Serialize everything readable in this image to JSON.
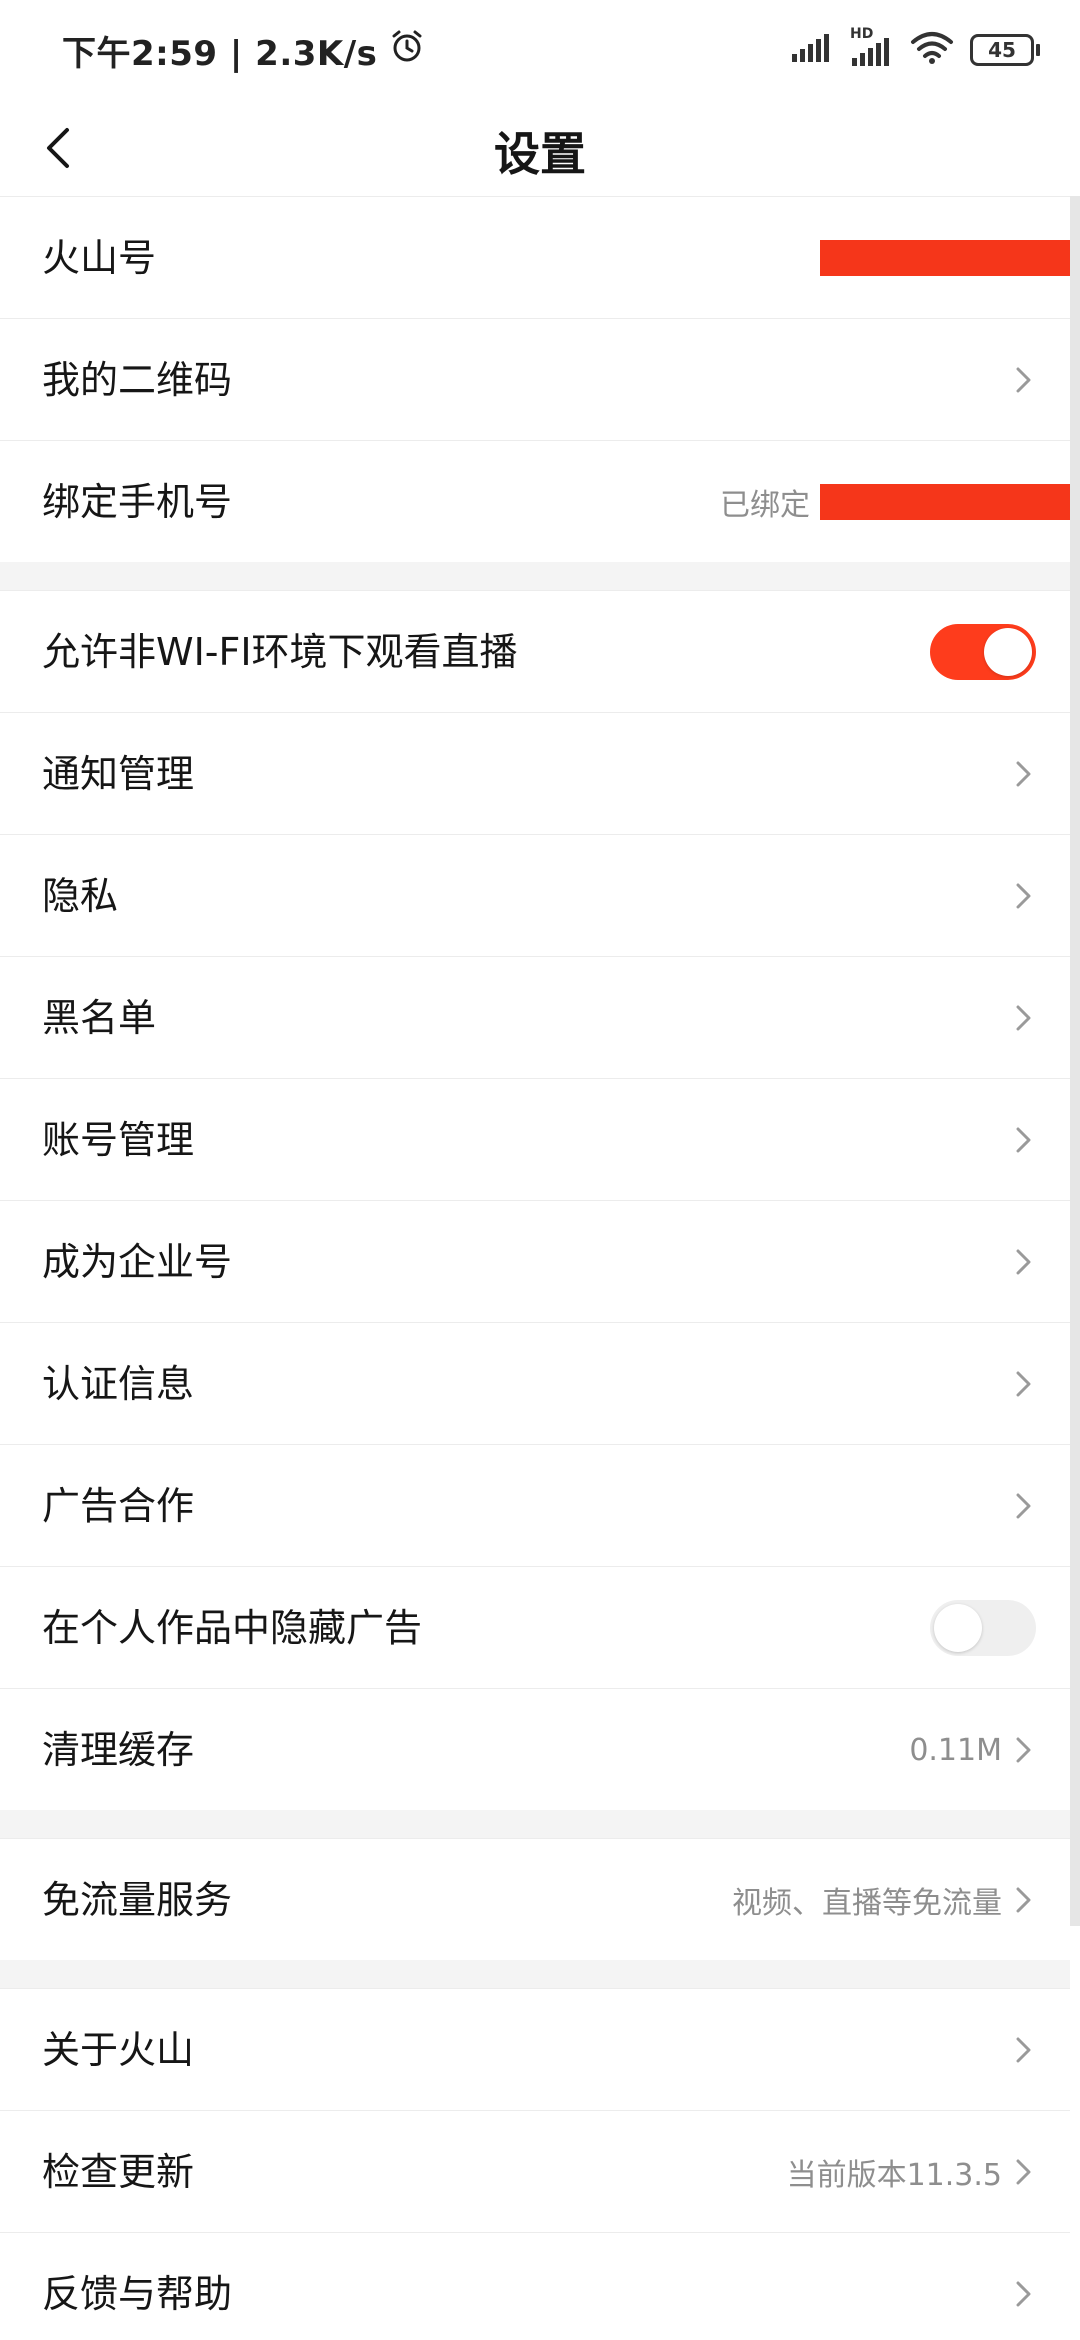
{
  "status_bar": {
    "time_speed": "下午2:59 | 2.3K/s",
    "signal_hd": "HD",
    "battery": "45"
  },
  "nav": {
    "title": "设置"
  },
  "colors": {
    "accent": "#fe3c1c",
    "redaction": "#f5361a"
  },
  "sections": [
    {
      "rows": [
        {
          "id": "huoshan-id",
          "label": "火山号",
          "value": "",
          "redacted": true
        },
        {
          "id": "qr-code",
          "label": "我的二维码",
          "value": "",
          "chevron": true
        },
        {
          "id": "bind-phone",
          "label": "绑定手机号",
          "value": "已绑定",
          "redacted": true
        }
      ]
    },
    {
      "rows": [
        {
          "id": "wifi-live",
          "label": "允许非WI-FI环境下观看直播",
          "toggle": true,
          "toggle_on": true
        },
        {
          "id": "notifications",
          "label": "通知管理",
          "chevron": true
        },
        {
          "id": "privacy",
          "label": "隐私",
          "chevron": true
        },
        {
          "id": "blacklist",
          "label": "黑名单",
          "chevron": true
        },
        {
          "id": "account",
          "label": "账号管理",
          "chevron": true
        },
        {
          "id": "enterprise",
          "label": "成为企业号",
          "chevron": true
        },
        {
          "id": "verification",
          "label": "认证信息",
          "chevron": true
        },
        {
          "id": "ads-coop",
          "label": "广告合作",
          "chevron": true
        },
        {
          "id": "hide-ads",
          "label": "在个人作品中隐藏广告",
          "toggle": true,
          "toggle_on": false
        },
        {
          "id": "clear-cache",
          "label": "清理缓存",
          "value": "0.11M",
          "chevron": true
        }
      ]
    },
    {
      "rows": [
        {
          "id": "free-data",
          "label": "免流量服务",
          "value": "视频、直播等免流量",
          "chevron": true
        }
      ]
    },
    {
      "rows": [
        {
          "id": "about",
          "label": "关于火山",
          "chevron": true
        },
        {
          "id": "check-update",
          "label": "检查更新",
          "value": "当前版本11.3.5",
          "chevron": true
        },
        {
          "id": "feedback",
          "label": "反馈与帮助",
          "chevron": true
        }
      ]
    }
  ]
}
